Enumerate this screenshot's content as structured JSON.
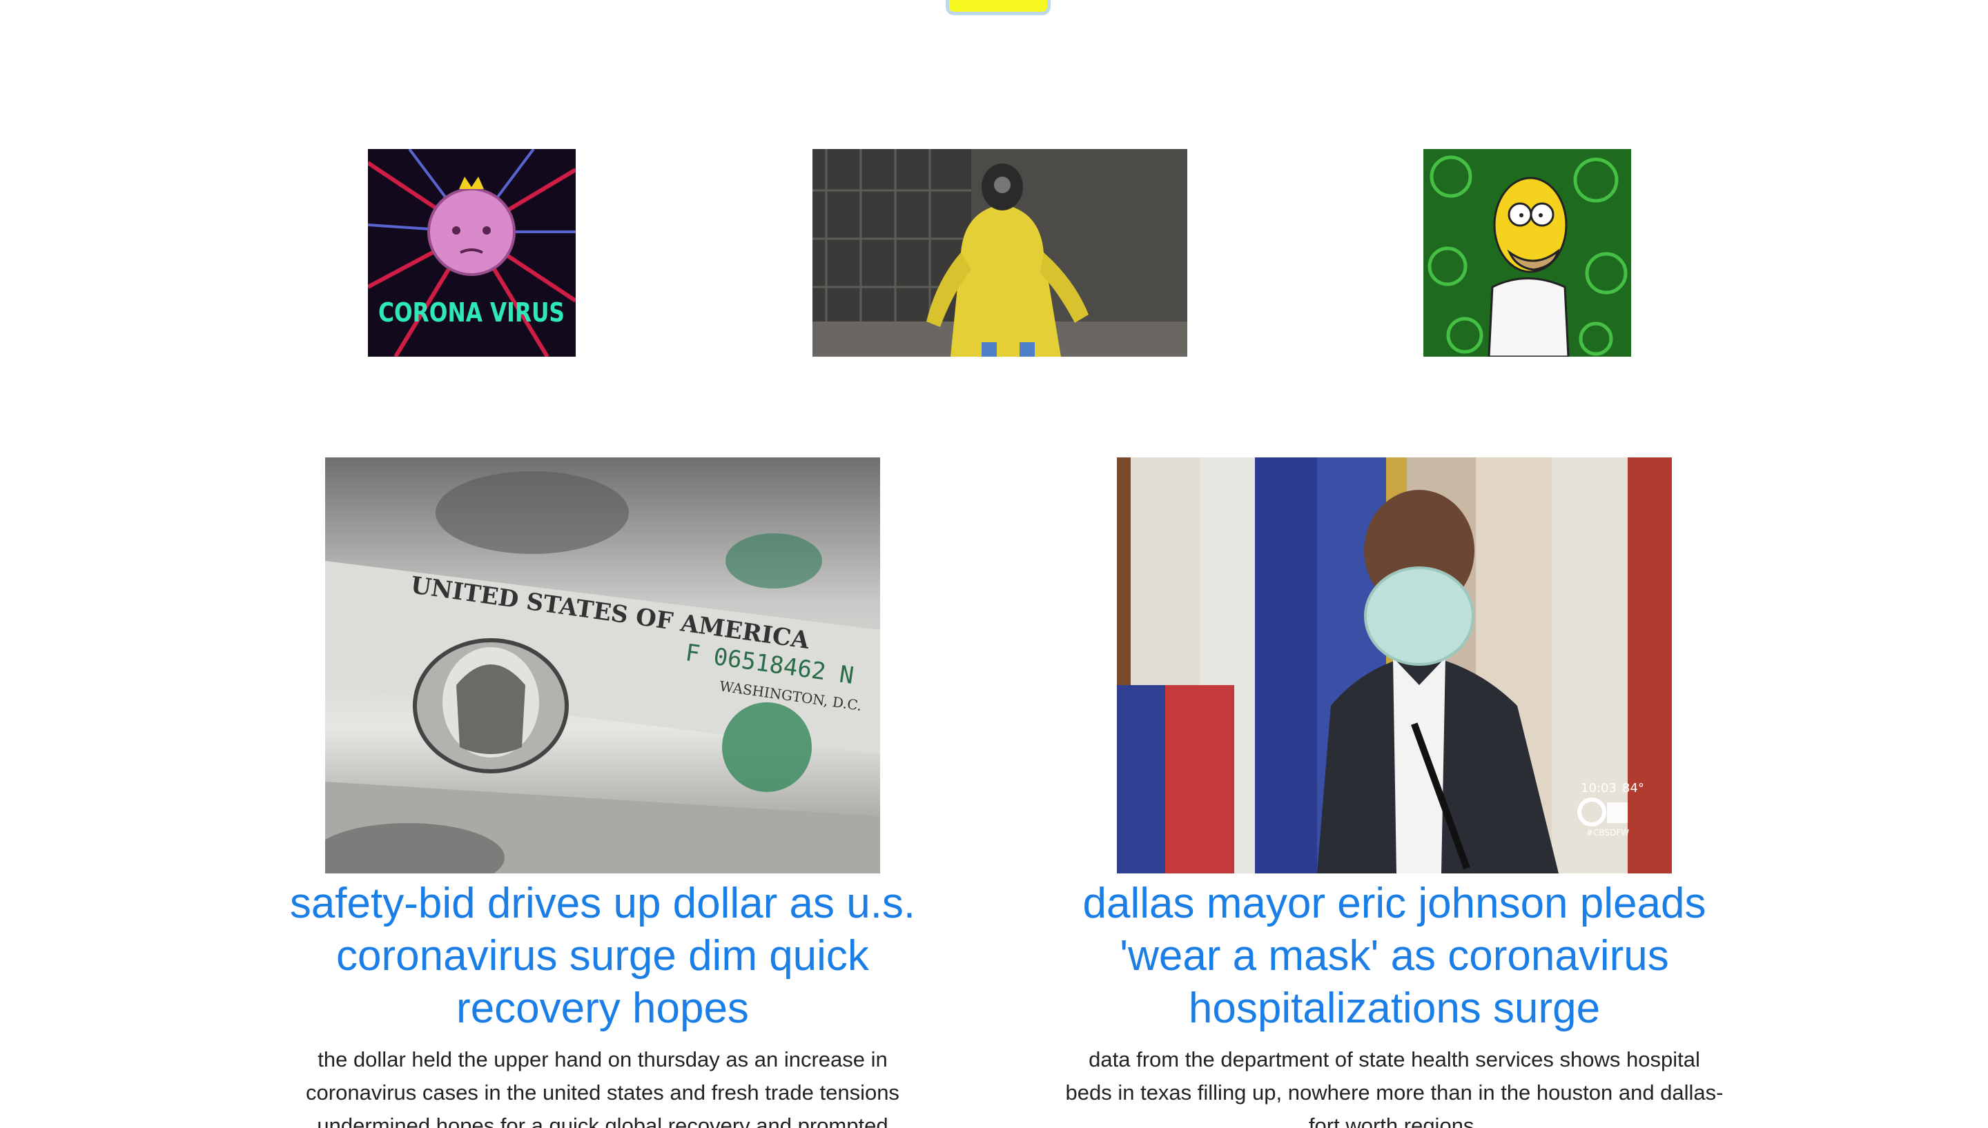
{
  "top_button": {
    "label": "",
    "color": "#f7f721"
  },
  "gifs": [
    {
      "caption_text": "CORONA VIRUS"
    },
    {
      "caption_text": ""
    },
    {
      "caption_text": ""
    }
  ],
  "articles": [
    {
      "headline": "safety-bid drives up dollar as u.s. coronavirus surge dim quick recovery hopes",
      "summary": "the dollar held the upper hand on thursday as an increase in coronavirus cases in the united states and fresh trade tensions undermined hopes for a quick global recovery and prompted",
      "image_text": {
        "line1": "UNITED STATES OF AMERICA",
        "serial": "F 06518462 N",
        "city": "WASHINGTON, D.C."
      }
    },
    {
      "headline": "dallas mayor eric johnson pleads 'wear a mask' as coronavirus hospitalizations surge",
      "summary": "data from the department of state health services shows hospital beds in texas filling up, nowhere more than in the houston and dallas-fort worth regions.",
      "image_text": {
        "time": "10:03",
        "temp": "84°",
        "channel": "#CBSDFW"
      }
    }
  ],
  "colors": {
    "link": "#1a7ee6",
    "text": "#222222",
    "button_border": "#bcd9ec"
  }
}
